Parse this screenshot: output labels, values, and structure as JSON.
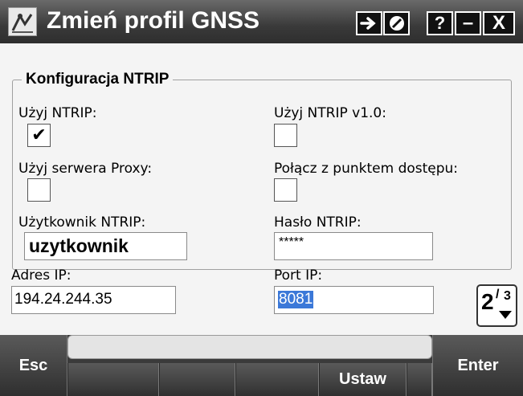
{
  "window": {
    "title": "Zmień profil GNSS",
    "buttons": {
      "ok": "➔",
      "close_small": "✖",
      "help": "?",
      "minimize": "–",
      "close": "X"
    }
  },
  "group": {
    "legend": "Konfiguracja NTRIP",
    "use_ntrip": {
      "label": "Użyj NTRIP:",
      "checked": true,
      "mark": "✔"
    },
    "use_ntrip_v10": {
      "label": "Użyj NTRIP v1.0:",
      "checked": false
    },
    "use_proxy": {
      "label": "Użyj serwera Proxy:",
      "checked": false
    },
    "connect_mountpoint": {
      "label": "Połącz z punktem dostępu:",
      "checked": false
    },
    "ntrip_user": {
      "label": "Użytkownik NTRIP:",
      "value": "uzytkownik"
    },
    "ntrip_password": {
      "label": "Hasło NTRIP:",
      "value": "*****"
    }
  },
  "ip_address": {
    "label": "Adres IP:",
    "value": "194.24.244.35"
  },
  "ip_port": {
    "label": "Port IP:",
    "value": "8081"
  },
  "page_indicator": {
    "current": "2",
    "total": "3"
  },
  "softkeys": {
    "esc": "Esc",
    "enter": "Enter",
    "set": "Ustaw"
  },
  "colors": {
    "title_bar": "#3a3a3a",
    "selection": "#3b78d8",
    "softkey_bg": "#3b3b3b"
  }
}
